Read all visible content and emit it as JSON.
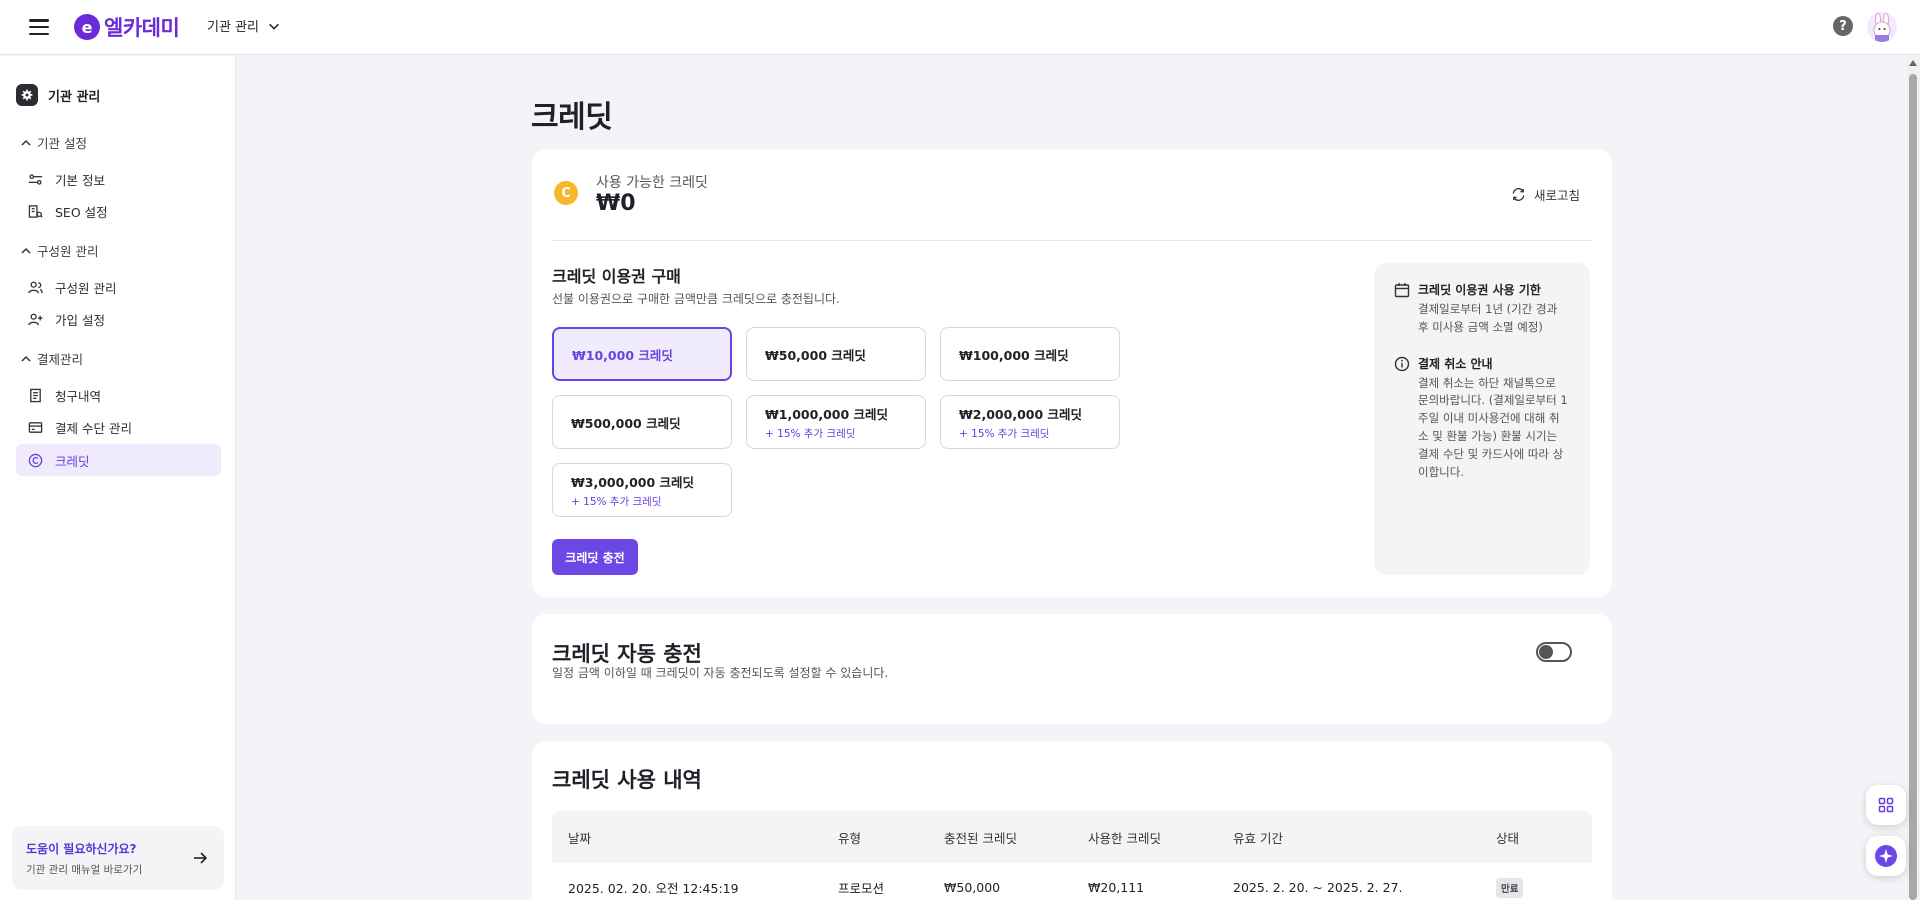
{
  "header": {
    "logo_mark": "e",
    "logo_text": "엘카데미",
    "org_select": "기관 관리",
    "help": "?"
  },
  "sidebar": {
    "title": "기관 관리",
    "groups": [
      {
        "label": "기관 설정"
      },
      {
        "label": "구성원 관리"
      },
      {
        "label": "결제관리"
      }
    ],
    "items": [
      {
        "label": "기본 정보"
      },
      {
        "label": "SEO 설정"
      },
      {
        "label": "구성원 관리"
      },
      {
        "label": "가입 설정"
      },
      {
        "label": "청구내역"
      },
      {
        "label": "결제 수단 관리"
      },
      {
        "label": "크레딧"
      }
    ],
    "help_card": {
      "title": "도움이 필요하신가요?",
      "subtitle": "기관 관리 매뉴얼 바로가기"
    }
  },
  "page": {
    "title": "크레딧"
  },
  "balance": {
    "coin": "C",
    "label": "사용 가능한 크레딧",
    "value": "₩0",
    "refresh": "새로고침"
  },
  "purchase": {
    "title": "크레딧 이용권 구매",
    "description": "선불 이용권으로 구매한 금액만큼 크레딧으로 충전됩니다.",
    "options": [
      {
        "amount": "₩10,000 크레딧",
        "bonus": ""
      },
      {
        "amount": "₩50,000 크레딧",
        "bonus": ""
      },
      {
        "amount": "₩100,000 크레딧",
        "bonus": ""
      },
      {
        "amount": "₩500,000 크레딧",
        "bonus": ""
      },
      {
        "amount": "₩1,000,000 크레딧",
        "bonus": "+ 15% 추가 크레딧"
      },
      {
        "amount": "₩2,000,000 크레딧",
        "bonus": "+ 15% 추가 크레딧"
      },
      {
        "amount": "₩3,000,000 크레딧",
        "bonus": "+ 15% 추가 크레딧"
      }
    ],
    "selected_index": 0,
    "charge_button": "크레딧 충전"
  },
  "info": {
    "blocks": [
      {
        "title": "크레딧 이용권 사용 기한",
        "body": "결제일로부터 1년 (기간 경과 후 미사용 금액 소멸 예정)"
      },
      {
        "title": "결제 취소 안내",
        "body": "결제 취소는 하단 채널톡으로 문의바랍니다. (결제일로부터 1주일 이내 미사용건에 대해 취소 및 환불 가능) 환불 시기는 결제 수단 및 카드사에 따라 상이합니다."
      }
    ]
  },
  "auto_charge": {
    "title": "크레딧 자동 충전",
    "description": "일정 금액 이하일 때 크레딧이 자동 충전되도록 설정할 수 있습니다.",
    "enabled": false
  },
  "history": {
    "title": "크레딧 사용 내역",
    "columns": [
      "날짜",
      "유형",
      "충전된 크레딧",
      "사용한 크레딧",
      "유효 기간",
      "상태"
    ],
    "rows": [
      [
        "2025. 02. 20. 오전 12:45:19",
        "프로모션",
        "₩50,000",
        "₩20,111",
        "2025. 2. 20. ~ 2025. 2. 27.",
        "만료"
      ]
    ]
  },
  "colors": {
    "brand": "#6c2bd9",
    "accent": "#6b47e6",
    "coin": "#f7b92b"
  }
}
